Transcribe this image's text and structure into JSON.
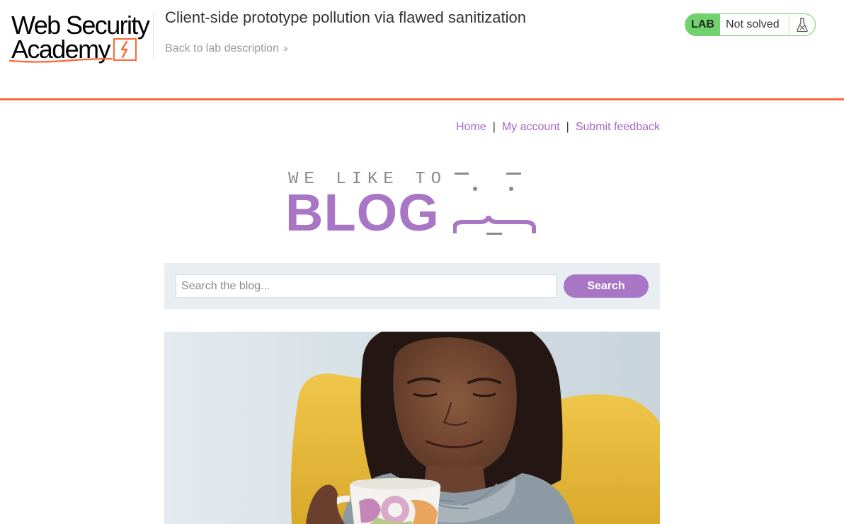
{
  "academy": {
    "logo_line1": "Web Security",
    "logo_line2": "Academy",
    "lab_title": "Client-side prototype pollution via flawed sanitization",
    "back_link": "Back to lab description",
    "status_badge": "LAB",
    "status_text": "Not solved"
  },
  "blog": {
    "nav": {
      "home": "Home",
      "separator": "|",
      "my_account": "My account",
      "submit_feedback": "Submit feedback"
    },
    "logo": {
      "tagline": "WE LIKE TO",
      "word": "BLOG"
    },
    "search": {
      "placeholder": "Search the blog...",
      "button": "Search"
    }
  },
  "colors": {
    "accent_orange": "#ff6633",
    "lab_green": "#70d16d",
    "blog_purple": "#a876c4",
    "search_panel": "#e9eef2"
  },
  "icons": {
    "back_chevron": "double-chevron-right-icon",
    "status_flask": "flask-icon"
  }
}
